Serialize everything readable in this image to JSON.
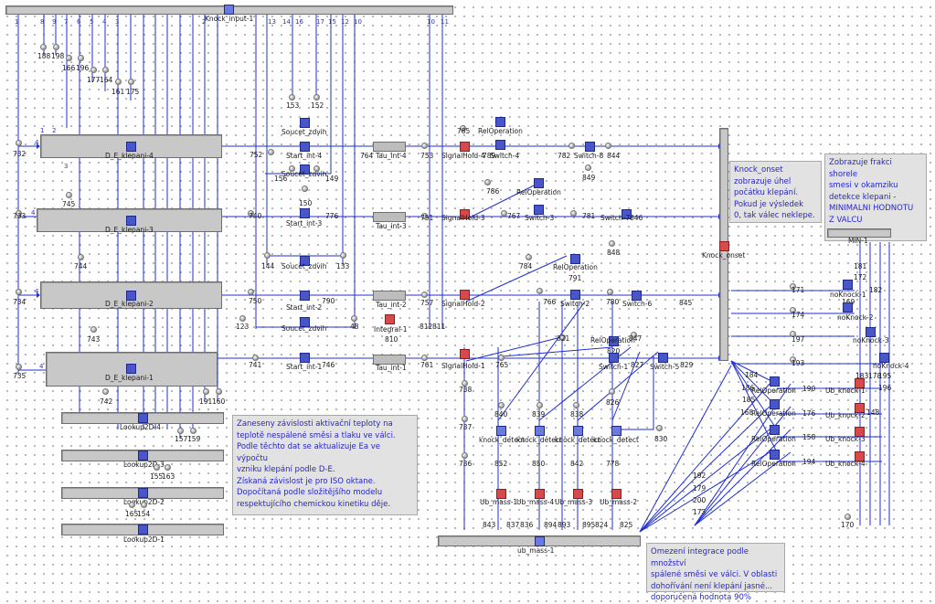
{
  "blocks": {
    "knock_input": "Knock_input-1",
    "de4": "D_E_klepani-4",
    "de3": "D_E_klepani-3",
    "de2": "D_E_klepani-2",
    "de1": "D_E_klepani-1",
    "lk4": "Lookup2D-4",
    "lk3": "Lookup2D-3",
    "lk2": "Lookup2D-2",
    "lk1": "Lookup2D-1",
    "sz1": "Soucet_zdvih",
    "sz2": "Soucet_zdvih",
    "sz3": "Soucet_zdvih",
    "sz4": "Soucet_zdvih",
    "si4": "Start_int-4",
    "si3": "Start_int-3",
    "si2": "Start_int-2",
    "si1": "Start_int-1",
    "ti4": "Tau_int-4",
    "ti3": "Tau_int-3",
    "ti2": "Tau_int-2",
    "ti1": "Tau_int-1",
    "integral": "Integral-1",
    "sh4": "SignalHold-4",
    "sh3": "SignalHold-3",
    "sh2": "SignalHold-2",
    "sh1": "SignalHold-1",
    "ro1": "RelOperation",
    "ro2": "RelOperation",
    "ro3": "RelOperation",
    "ro4": "RelOperation",
    "sw4": "Switch-4",
    "sw3": "Switch-3",
    "sw2": "Switch-2",
    "sw1": "Switch-1",
    "sw8": "Switch-8",
    "sw7": "Switch-7",
    "sw6": "Switch-6",
    "sw5": "Switch-5",
    "kd1": "knock_detect",
    "kd2": "knock_detect",
    "kd3": "knock_detect",
    "kd4": "knock_detect",
    "um1": "Ub_mass-1",
    "um2": "Ub_mass-2",
    "um3": "Ub_mass-3",
    "um4": "Ub_mass-4",
    "ubmass": "ub_mass-1",
    "knock_onset": "Knock_onset",
    "min1": "MIN-1",
    "nk1": "noKnock-1",
    "nk2": "noKnock-2",
    "nk3": "noKnock-3",
    "nk4": "noKnock-4",
    "rr1": "RelOperation",
    "rr2": "RelOperation",
    "rr3": "RelOperation",
    "rr4": "RelOperation",
    "uk1": "Ub_knock-1",
    "uk2": "Ub_knock-2",
    "uk3": "Ub_knock-3",
    "uk4": "Ub_knock-4"
  },
  "notes": {
    "knock_onset": [
      "Knock_onset",
      "zobrazuje úhel",
      "počátku klepání.",
      "Pokud je výsledek",
      "0, tak válec neklepe."
    ],
    "min": [
      "Zobrazuje frakci shorele",
      "smesi v okamziku",
      "detekce klepani -",
      "MINIMALNI HODNOTU",
      "Z VALCU"
    ],
    "activation": [
      "Zaneseny závislosti aktivační teploty na",
      "teplotě nespálené směsi a tlaku ve válci.",
      "Podle těchto dat se aktualizuje Ea ve výpočtu",
      "vzniku klepání podle D-E.",
      "Získaná závislost je pro ISO oktane.",
      "Dopočítaná podle složitějšího modelu",
      "respektujícího chemickou kinetiku děje."
    ],
    "omezeni": [
      "Omezení integrace podle množství",
      "spálené směsi ve válci.   V oblasti",
      "dohořívání není klepání jasné...",
      "doporučená hodnota 90%"
    ]
  },
  "input_pins": [
    "1",
    "8",
    "9",
    "7",
    "6",
    "5",
    "4",
    "3",
    "2",
    "13",
    "14",
    "16",
    "17",
    "15",
    "12",
    "10",
    "10",
    "11"
  ],
  "numbers": {
    "n188": "188",
    "n198": "198",
    "n166": "166",
    "n196": "196",
    "n177": "177",
    "n164": "164",
    "n161": "161",
    "n175": "175",
    "n732": "732",
    "n733": "733",
    "n734": "734",
    "n735": "735",
    "n745": "745",
    "n744": "744",
    "n743": "743",
    "n742": "742",
    "n191": "191",
    "n160": "160",
    "n157": "157",
    "n159": "159",
    "n155": "155",
    "n163": "163",
    "n165": "165",
    "n154": "154",
    "n153": "153",
    "n152": "152",
    "n156": "156",
    "n149": "149",
    "n150": "150",
    "n144": "144",
    "n133": "133",
    "n123": "123",
    "n48": "48",
    "n752": "752",
    "n740": "740",
    "n750": "750",
    "n741": "741",
    "n776": "776",
    "n790": "790",
    "n746": "746",
    "n764": "764",
    "n753": "753",
    "n751": "751",
    "n757": "757",
    "n761": "761",
    "n812": "812",
    "n811": "811",
    "n810": "810",
    "n785": "785",
    "n789": "789",
    "n786": "786",
    "n767": "767",
    "n784": "784",
    "n766": "766",
    "n765": "765",
    "n821": "821",
    "n782": "782",
    "n844": "844",
    "n849": "849",
    "n781": "781",
    "n846": "846",
    "n848": "848",
    "n791": "791",
    "n780": "780",
    "n845": "845",
    "n847": "847",
    "n827": "827",
    "n829": "829",
    "n820": "820",
    "n826": "826",
    "n830": "830",
    "n738": "738",
    "n737": "737",
    "n736": "736",
    "n840": "840",
    "n839": "839",
    "n838": "838",
    "n852": "852",
    "n850": "850",
    "n842": "842",
    "n778": "778",
    "n843": "843",
    "n837": "837",
    "n836": "836",
    "n894": "894",
    "n893": "893",
    "n895": "895",
    "n824": "824",
    "n825": "825",
    "n171": "171",
    "n174": "174",
    "n197": "197",
    "n193": "193",
    "n181": "181",
    "n172": "172",
    "n169": "169",
    "n182": "182",
    "n173x": "173",
    "n184": "184",
    "n186": "186",
    "n185": "185",
    "n168": "168",
    "n190": "190",
    "n176": "176",
    "n158": "158",
    "n194": "194",
    "n183": "183",
    "n178": "178",
    "n195": "195",
    "n148": "148",
    "n192": "192",
    "n179": "179",
    "n200": "200",
    "n173": "173",
    "n170": "170"
  },
  "pins": {
    "p4": "4",
    "p3": "3",
    "p2": "2",
    "p1": "1"
  }
}
